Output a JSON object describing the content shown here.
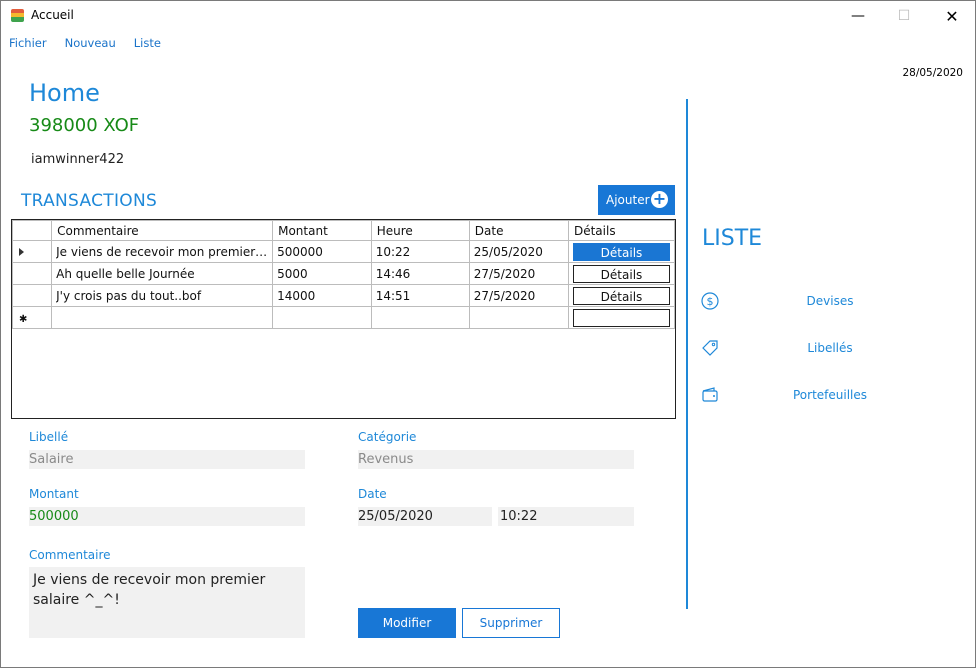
{
  "window": {
    "title": "Accueil",
    "minimize": "—",
    "maximize": "☐",
    "close": "✕"
  },
  "menu": [
    "Fichier",
    "Nouveau",
    "Liste"
  ],
  "header": {
    "date": "28/05/2020",
    "title": "Home",
    "balance": "398000 XOF",
    "username": "iamwinner422"
  },
  "transactions": {
    "title": "TRANSACTIONS",
    "add_label": "Ajouter",
    "columns": [
      "Commentaire",
      "Montant",
      "Heure",
      "Date",
      "Détails"
    ],
    "rows": [
      {
        "commentaire": "Je viens de recevoir mon premier salaire ^_^!",
        "montant": "500000",
        "heure": "10:22",
        "date": "25/05/2020",
        "details": "Détails",
        "selected": true
      },
      {
        "commentaire": "Ah quelle belle Journée",
        "montant": "5000",
        "heure": "14:46",
        "date": "27/5/2020",
        "details": "Détails",
        "selected": false
      },
      {
        "commentaire": "J'y crois pas du tout..bof",
        "montant": "14000",
        "heure": "14:51",
        "date": "27/5/2020",
        "details": "Détails",
        "selected": false
      }
    ]
  },
  "detail": {
    "libelle_label": "Libellé",
    "libelle_value": "Salaire",
    "categorie_label": "Catégorie",
    "categorie_value": "Revenus",
    "montant_label": "Montant",
    "montant_value": "500000",
    "date_label": "Date",
    "date_value": "25/05/2020",
    "time_value": "10:22",
    "commentaire_label": "Commentaire",
    "commentaire_value": "Je viens de recevoir mon premier salaire ^_^!",
    "modifier_label": "Modifier",
    "supprimer_label": "Supprimer"
  },
  "side": {
    "title": "LISTE",
    "items": [
      {
        "label": "Devises",
        "icon": "dollar-circle-icon"
      },
      {
        "label": "Libellés",
        "icon": "tag-icon"
      },
      {
        "label": "Portefeuilles",
        "icon": "wallet-icon"
      }
    ]
  },
  "colors": {
    "accent": "#1877d6",
    "title_blue": "#1e88d8",
    "balance_green": "#178a17"
  }
}
